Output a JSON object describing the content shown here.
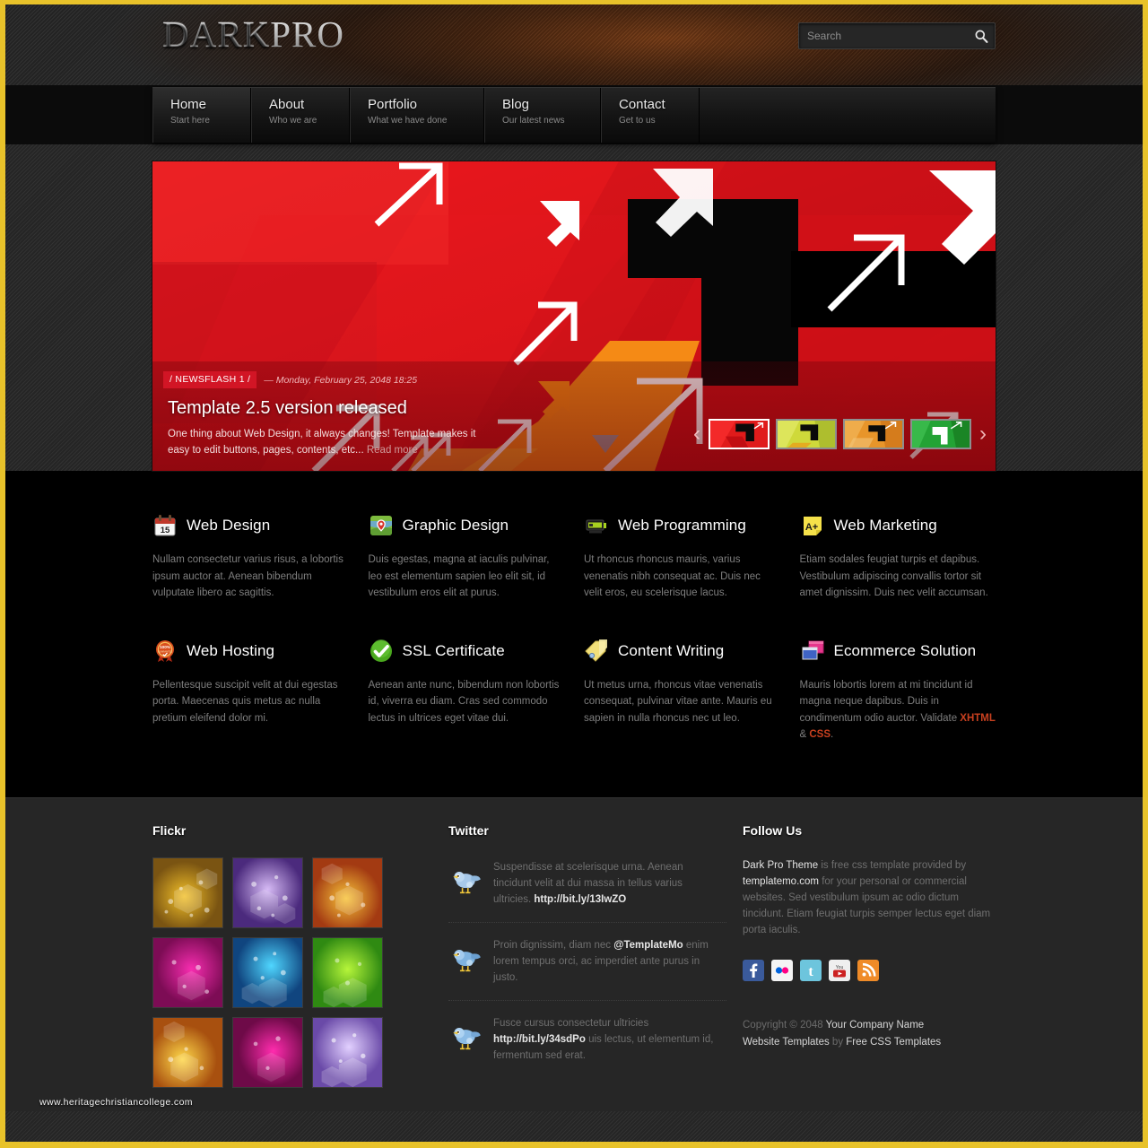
{
  "site": {
    "logo_primary": "DARK",
    "logo_secondary": "PRO"
  },
  "search": {
    "placeholder": "Search",
    "value": "",
    "icon": "search-icon"
  },
  "nav": {
    "items": [
      {
        "label": "Home",
        "sub": "Start here"
      },
      {
        "label": "About",
        "sub": "Who we are"
      },
      {
        "label": "Portfolio",
        "sub": "What we have done"
      },
      {
        "label": "Blog",
        "sub": "Our latest news"
      },
      {
        "label": "Contact",
        "sub": "Get to us"
      }
    ]
  },
  "banner": {
    "flash_tag": "/ NEWSFLASH 1 /",
    "date": "— Monday, February 25, 2048 18:25",
    "title": "Template 2.5 version released",
    "body": "One thing about Web Design, it always changes! Template makes it easy to edit buttons, pages, contents, etc...",
    "read_more": "Read more",
    "prev_arrow": "‹",
    "next_arrow": "›",
    "thumbs": [
      {
        "name": "slide-thumb-red",
        "color": "#e01b1b",
        "active": true
      },
      {
        "name": "slide-thumb-yellow",
        "color": "#cfd93a",
        "active": false
      },
      {
        "name": "slide-thumb-orange",
        "color": "#e8952a",
        "active": false
      },
      {
        "name": "slide-thumb-green",
        "color": "#23a335",
        "active": false
      }
    ]
  },
  "services": [
    {
      "icon": "calendar-icon",
      "title": "Web Design",
      "text": "Nullam consectetur varius risus, a lobortis ipsum auctor at. Aenean bibendum vulputate libero ac sagittis."
    },
    {
      "icon": "map-pin-icon",
      "title": "Graphic Design",
      "text": "Duis egestas, magna at iaculis pulvinar, leo est elementum sapien leo elit sit, id vestibulum eros elit at purus."
    },
    {
      "icon": "server-icon",
      "title": "Web Programming",
      "text": "Ut rhoncus rhoncus mauris, varius venenatis nibh consequat ac. Duis nec velit eros, eu scelerisque lacus."
    },
    {
      "icon": "grade-note-icon",
      "title": "Web Marketing",
      "text": "Etiam sodales feugiat turpis et dapibus. Vestibulum adipiscing convallis tortor sit amet dignissim. Duis nec velit accumsan."
    },
    {
      "icon": "guarantee-badge-icon",
      "title": "Web Hosting",
      "text": "Pellentesque suscipit velit at dui egestas porta. Maecenas quis metus ac nulla pretium eleifend dolor mi."
    },
    {
      "icon": "green-check-icon",
      "title": "SSL Certificate",
      "text": "Aenean ante nunc, bibendum non lobortis id, viverra eu diam. Cras sed commodo lectus in ultrices eget vitae dui."
    },
    {
      "icon": "tags-icon",
      "title": "Content Writing",
      "text": "Ut metus urna, rhoncus vitae venenatis consequat, pulvinar vitae ante. Mauris eu sapien in nulla rhoncus nec ut leo."
    },
    {
      "icon": "windows-icon",
      "title": "Ecommerce Solution",
      "text_prefix": "Mauris lobortis lorem at mi tincidunt id magna neque dapibus. Duis in condimentum odio auctor. Validate ",
      "link1": "XHTML",
      "text_mid": " & ",
      "link2": "CSS",
      "text_suffix": "."
    }
  ],
  "footer": {
    "flickr": {
      "title": "Flickr",
      "thumbs": [
        {
          "name": "flickr-thumb-gold",
          "c1": "#f2c029",
          "c2": "#7a5412"
        },
        {
          "name": "flickr-thumb-purple",
          "c1": "#b58ce8",
          "c2": "#4b2a7d"
        },
        {
          "name": "flickr-thumb-orange",
          "c1": "#f09020",
          "c2": "#a33a12"
        },
        {
          "name": "flickr-thumb-magenta",
          "c1": "#e0189b",
          "c2": "#7d0c55"
        },
        {
          "name": "flickr-thumb-blue",
          "c1": "#21b6f0",
          "c2": "#10457f"
        },
        {
          "name": "flickr-thumb-green",
          "c1": "#8ae018",
          "c2": "#2f8a12"
        },
        {
          "name": "flickr-thumb-amber",
          "c1": "#f8b018",
          "c2": "#a8500f"
        },
        {
          "name": "flickr-thumb-pink",
          "c1": "#f0179e",
          "c2": "#6e0a48"
        },
        {
          "name": "flickr-thumb-violet",
          "c1": "#c9a8f2",
          "c2": "#6a4aa8"
        }
      ]
    },
    "twitter": {
      "title": "Twitter",
      "tweets": [
        {
          "pre": "Suspendisse at scelerisque urna. Aenean tincidunt velit at dui massa in tellus varius ultricies. ",
          "link": "http://bit.ly/13IwZO",
          "post": ""
        },
        {
          "pre": "Proin dignissim, diam nec ",
          "link": "@TemplateMo",
          "post": " enim lorem tempus orci, ac imperdiet ante purus in justo."
        },
        {
          "pre": "Fusce cursus consectetur ultricies ",
          "link": "http://bit.ly/34sdPo",
          "post": " uis lectus, ut elementum id, fermentum sed erat."
        }
      ]
    },
    "follow": {
      "title": "Follow Us",
      "about_link1": "Dark Pro Theme",
      "about_mid1": " is free css template provided by ",
      "about_link2": "templatemo.com",
      "about_rest": " for your personal or commercial websites. Sed vestibulum ipsum ac odio dictum tincidunt. Etiam feugiat turpis semper lectus eget diam porta iaculis.",
      "social": [
        {
          "name": "facebook-icon",
          "label": "f",
          "bg": "#3a5a9b"
        },
        {
          "name": "flickr-icon",
          "label": "••",
          "bg": "#f2f2f2"
        },
        {
          "name": "twitter-icon",
          "label": "t",
          "bg": "#6dc5dd"
        },
        {
          "name": "youtube-icon",
          "label": "You",
          "bg": "#efefef"
        },
        {
          "name": "rss-icon",
          "label": "rss",
          "bg": "#ef8b28"
        }
      ],
      "copyright_pre": "Copyright © 2048 ",
      "copyright_company": "Your Company Name",
      "credit_link1": "Website Templates",
      "credit_mid": " by ",
      "credit_link2": "Free CSS Templates"
    }
  },
  "watermark": "www.heritagechristiancollege.com"
}
